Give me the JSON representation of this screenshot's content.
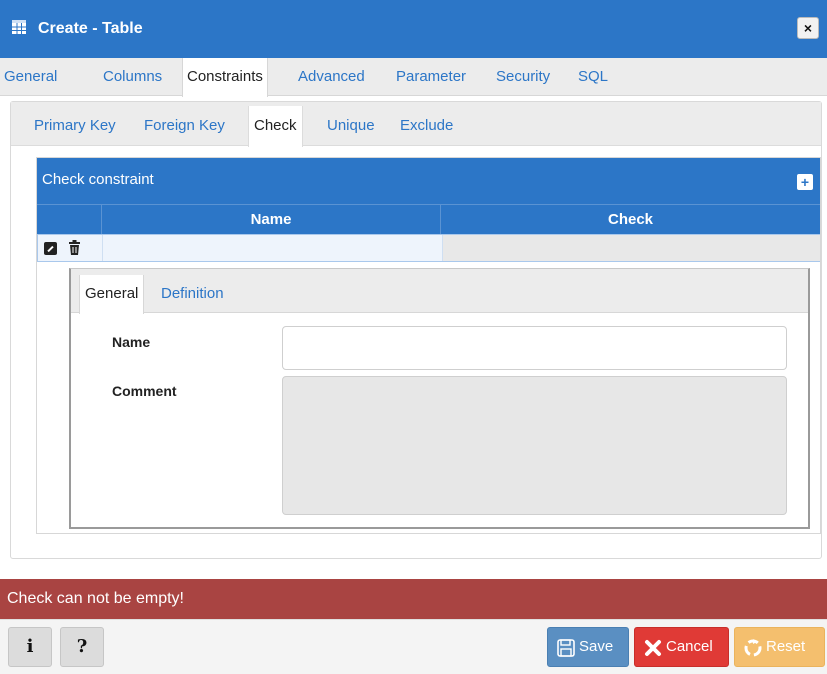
{
  "window": {
    "title": "Create - Table",
    "close_label": "×"
  },
  "main_tabs": [
    {
      "label": "General"
    },
    {
      "label": "Columns"
    },
    {
      "label": "Constraints",
      "active": true
    },
    {
      "label": "Advanced"
    },
    {
      "label": "Parameter"
    },
    {
      "label": "Security"
    },
    {
      "label": "SQL"
    }
  ],
  "sub_tabs": [
    {
      "label": "Primary Key"
    },
    {
      "label": "Foreign Key"
    },
    {
      "label": "Check",
      "active": true
    },
    {
      "label": "Unique"
    },
    {
      "label": "Exclude"
    }
  ],
  "grid": {
    "title": "Check constraint",
    "add_label": "+",
    "columns": [
      "Name",
      "Check"
    ],
    "rows": [
      {
        "name": "",
        "check": ""
      }
    ]
  },
  "subform": {
    "tabs": [
      {
        "label": "General",
        "active": true
      },
      {
        "label": "Definition"
      }
    ],
    "name_label": "Name",
    "name_value": "",
    "comment_label": "Comment",
    "comment_value": ""
  },
  "error_message": "Check can not be empty!",
  "footer": {
    "info_label": "i",
    "help_label": "?",
    "save_label": "Save",
    "cancel_label": "Cancel",
    "reset_label": "Reset"
  },
  "colors": {
    "primary": "#2c76c7",
    "error": "#a94442",
    "save": "#5a8fc2",
    "cancel": "#e03a36",
    "reset": "#f4bf6e"
  }
}
